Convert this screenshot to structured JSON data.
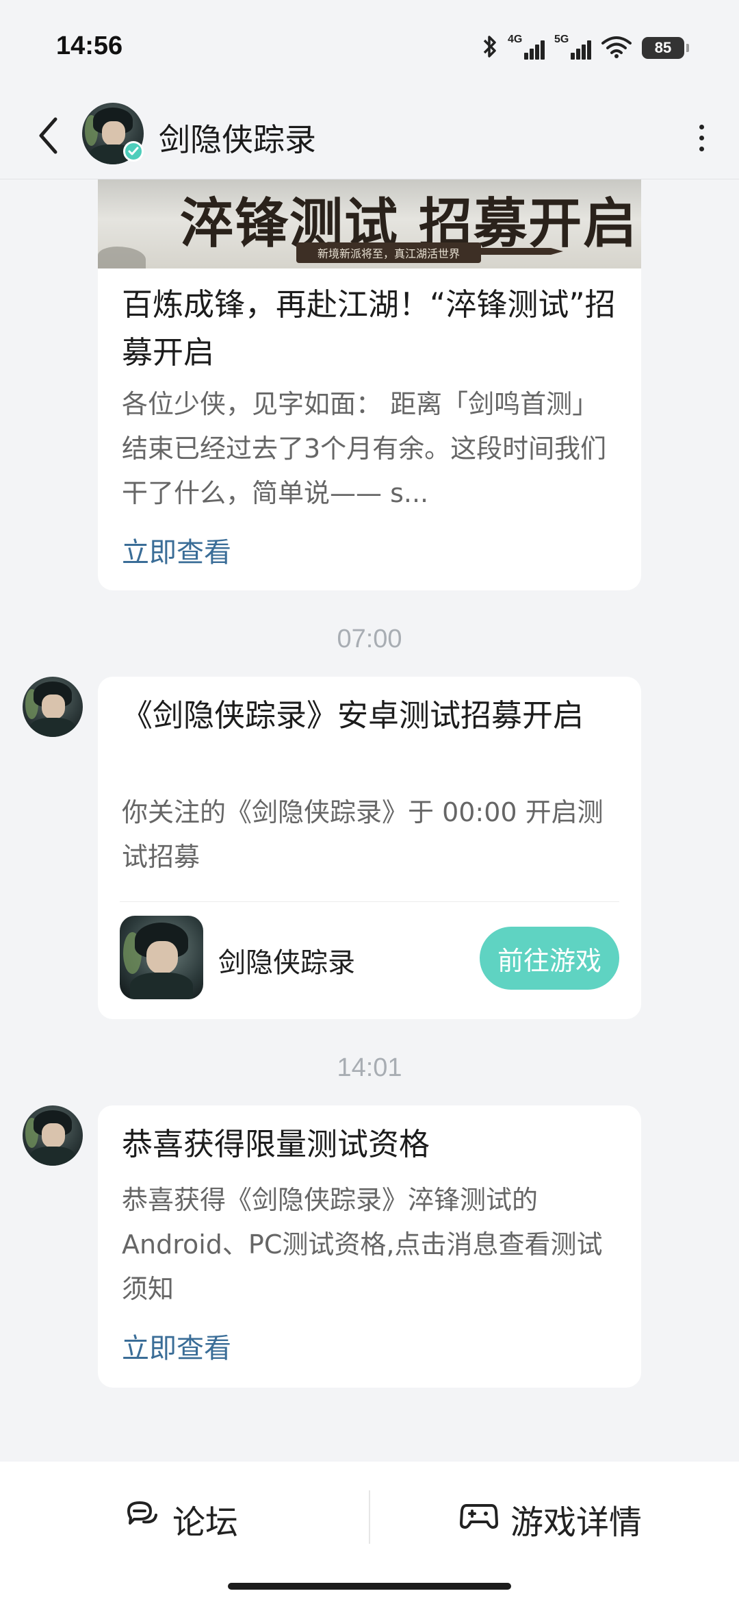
{
  "status_bar": {
    "time": "14:56",
    "network_4g": "4G",
    "network_5g": "5G",
    "battery": "85",
    "icons": [
      "bluetooth-icon",
      "signal-4g-icon",
      "signal-5g-icon",
      "wifi-icon",
      "battery-icon"
    ]
  },
  "header": {
    "title": "剑隐侠踪录",
    "icons": [
      "back-icon",
      "verified-icon",
      "more-icon"
    ]
  },
  "messages": [
    {
      "banner_title": "淬锋测试 招募开启",
      "banner_subtitle": "新境新派将至，真江湖活世界",
      "title": "百炼成锋，再赴江湖！“淬锋测试”招募开启",
      "desc": "各位少侠，见字如面： 距离「剑鸣首测」结束已经过去了3个月有余。这段时间我们干了什么，简单说—— s...",
      "link": "立即查看"
    },
    {
      "timestamp": "07:00",
      "title": "《剑隐侠踪录》安卓测试招募开启",
      "desc": "你关注的《剑隐侠踪录》于 00:00 开启测试招募",
      "game_name": "剑隐侠踪录",
      "button": "前往游戏"
    },
    {
      "timestamp": "14:01",
      "title": "恭喜获得限量测试资格",
      "desc": "恭喜获得《剑隐侠踪录》淬锋测试的Android、PC测试资格,点击消息查看测试须知",
      "link": "立即查看"
    }
  ],
  "bottom_bar": {
    "forum": "论坛",
    "game_details": "游戏详情",
    "icons": [
      "forum-icon",
      "gamepad-icon"
    ]
  },
  "colors": {
    "accent": "#5fd3c2",
    "link": "#3a6d97",
    "background": "#f3f4f6"
  }
}
